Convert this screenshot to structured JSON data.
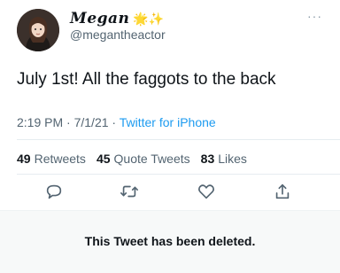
{
  "header": {
    "display_name": "Megan",
    "emoji": "🌟✨",
    "handle": "@megantheactor",
    "more_icon": "···"
  },
  "tweet": {
    "text": "July 1st! All the faggots to the back",
    "time": "2:19 PM",
    "date": "7/1/21",
    "separator": "·",
    "source": "Twitter for iPhone"
  },
  "stats": {
    "retweets_count": "49",
    "retweets_label": "Retweets",
    "quote_count": "45",
    "quote_label": "Quote Tweets",
    "likes_count": "83",
    "likes_label": "Likes"
  },
  "actions": {
    "icons": [
      "reply-icon",
      "retweet-icon",
      "like-icon",
      "share-icon"
    ]
  },
  "notice": {
    "text": "This Tweet has been deleted."
  },
  "colors": {
    "accent": "#1d9bf0",
    "text_primary": "#0f1419",
    "text_secondary": "#536471",
    "notice_background": "#f7f9f9"
  }
}
